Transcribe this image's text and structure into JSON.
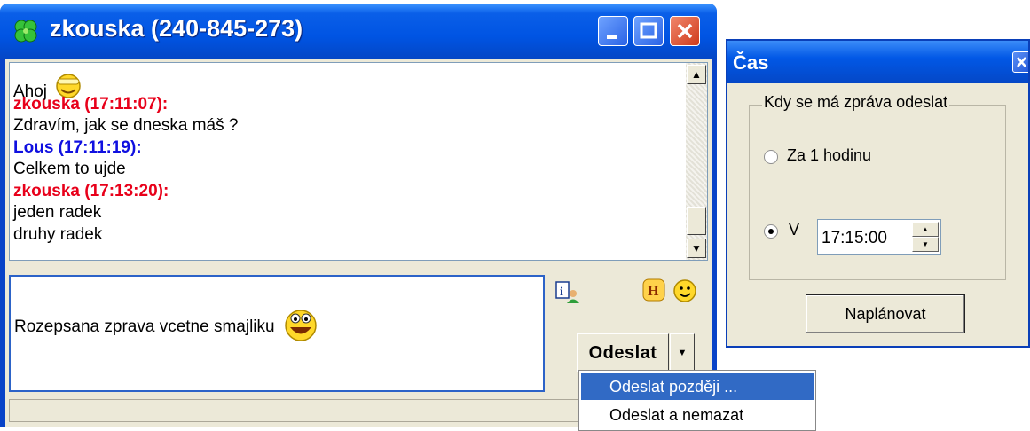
{
  "chat_window": {
    "title": "zkouska (240-845-273)",
    "title_icon": "clover-icon",
    "controls": [
      "minimize-icon",
      "maximize-icon",
      "close-icon"
    ]
  },
  "history": {
    "first_line": "Ahoj",
    "lines": [
      {
        "type": "sender",
        "sender": "zkouska",
        "text": "zkouska (17:11:07):",
        "color": "#e8001a"
      },
      {
        "type": "text",
        "text": "Zdravím, jak se dneska máš ?"
      },
      {
        "type": "sender",
        "sender": "Lous",
        "text": "Lous (17:11:19):",
        "color": "#1010e0"
      },
      {
        "type": "text",
        "text": "Celkem to ujde"
      },
      {
        "type": "sender",
        "sender": "zkouska",
        "text": "zkouska (17:13:20):",
        "color": "#e8001a"
      },
      {
        "type": "text",
        "text": "jeden radek"
      },
      {
        "type": "text",
        "text": "druhy radek"
      }
    ]
  },
  "compose": {
    "text": "Rozepsana zprava vcetne smajliku"
  },
  "toolbar": {
    "send_label": "Odeslat",
    "icons": [
      "info-icon",
      "history-h-icon",
      "smiley-icon"
    ]
  },
  "send_menu": {
    "items": [
      "Odeslat později ...",
      "Odeslat a nemazat"
    ],
    "selected_index": 0
  },
  "time_dialog": {
    "title": "Čas",
    "group_label": "Kdy se má zpráva odeslat",
    "option_1_hour": "Za 1 hodinu",
    "option_at": "V",
    "selected_option": "V",
    "time_value": "17:15:00",
    "schedule_button": "Naplánovat"
  },
  "colors": {
    "titlebar_blue": "#0054e3",
    "sender_red": "#e8001a",
    "sender_blue": "#1010e0",
    "menu_highlight": "#316ac5"
  }
}
